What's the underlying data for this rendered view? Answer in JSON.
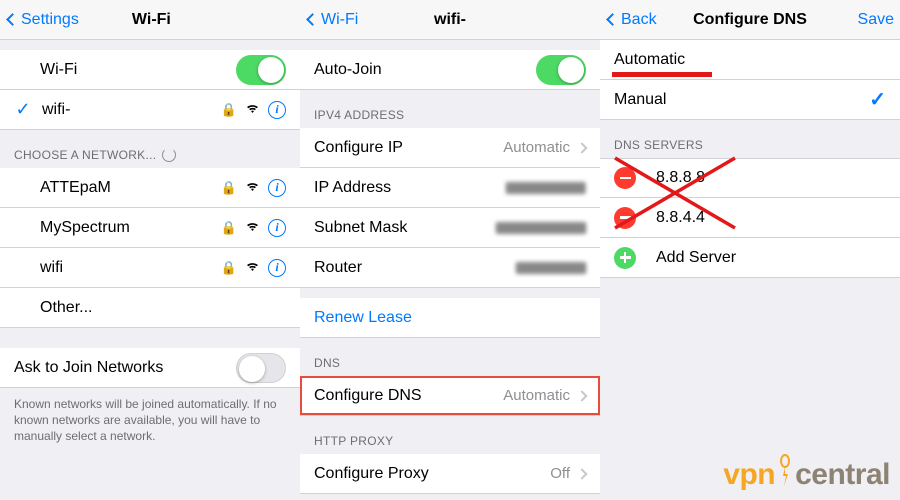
{
  "panel1": {
    "back": "Settings",
    "title": "Wi-Fi",
    "wifi_label": "Wi-Fi",
    "wifi_on": true,
    "connected": "wifi-",
    "choose_header": "CHOOSE A NETWORK...",
    "networks": [
      {
        "name": "ATTEpaM",
        "locked": true
      },
      {
        "name": "MySpectrum",
        "locked": true
      },
      {
        "name": "wifi",
        "locked": true
      }
    ],
    "other": "Other...",
    "ask_label": "Ask to Join Networks",
    "ask_on": false,
    "footer": "Known networks will be joined automatically. If no known networks are available, you will have to manually select a network."
  },
  "panel2": {
    "back": "Wi-Fi",
    "title": "wifi-",
    "autojoin_label": "Auto-Join",
    "autojoin_on": true,
    "ipv4_header": "IPV4 ADDRESS",
    "configure_ip_label": "Configure IP",
    "configure_ip_value": "Automatic",
    "ip_label": "IP Address",
    "subnet_label": "Subnet Mask",
    "router_label": "Router",
    "renew": "Renew Lease",
    "dns_header": "DNS",
    "configure_dns_label": "Configure DNS",
    "configure_dns_value": "Automatic",
    "proxy_header": "HTTP PROXY",
    "configure_proxy_label": "Configure Proxy",
    "configure_proxy_value": "Off"
  },
  "panel3": {
    "back": "Back",
    "title": "Configure DNS",
    "save": "Save",
    "option_auto": "Automatic",
    "option_manual": "Manual",
    "servers_header": "DNS SERVERS",
    "server1": "8.8.8.8",
    "server2": "8.8.4.4",
    "add_server": "Add Server"
  },
  "logo": {
    "vpn": "vpn",
    "central": "central"
  }
}
